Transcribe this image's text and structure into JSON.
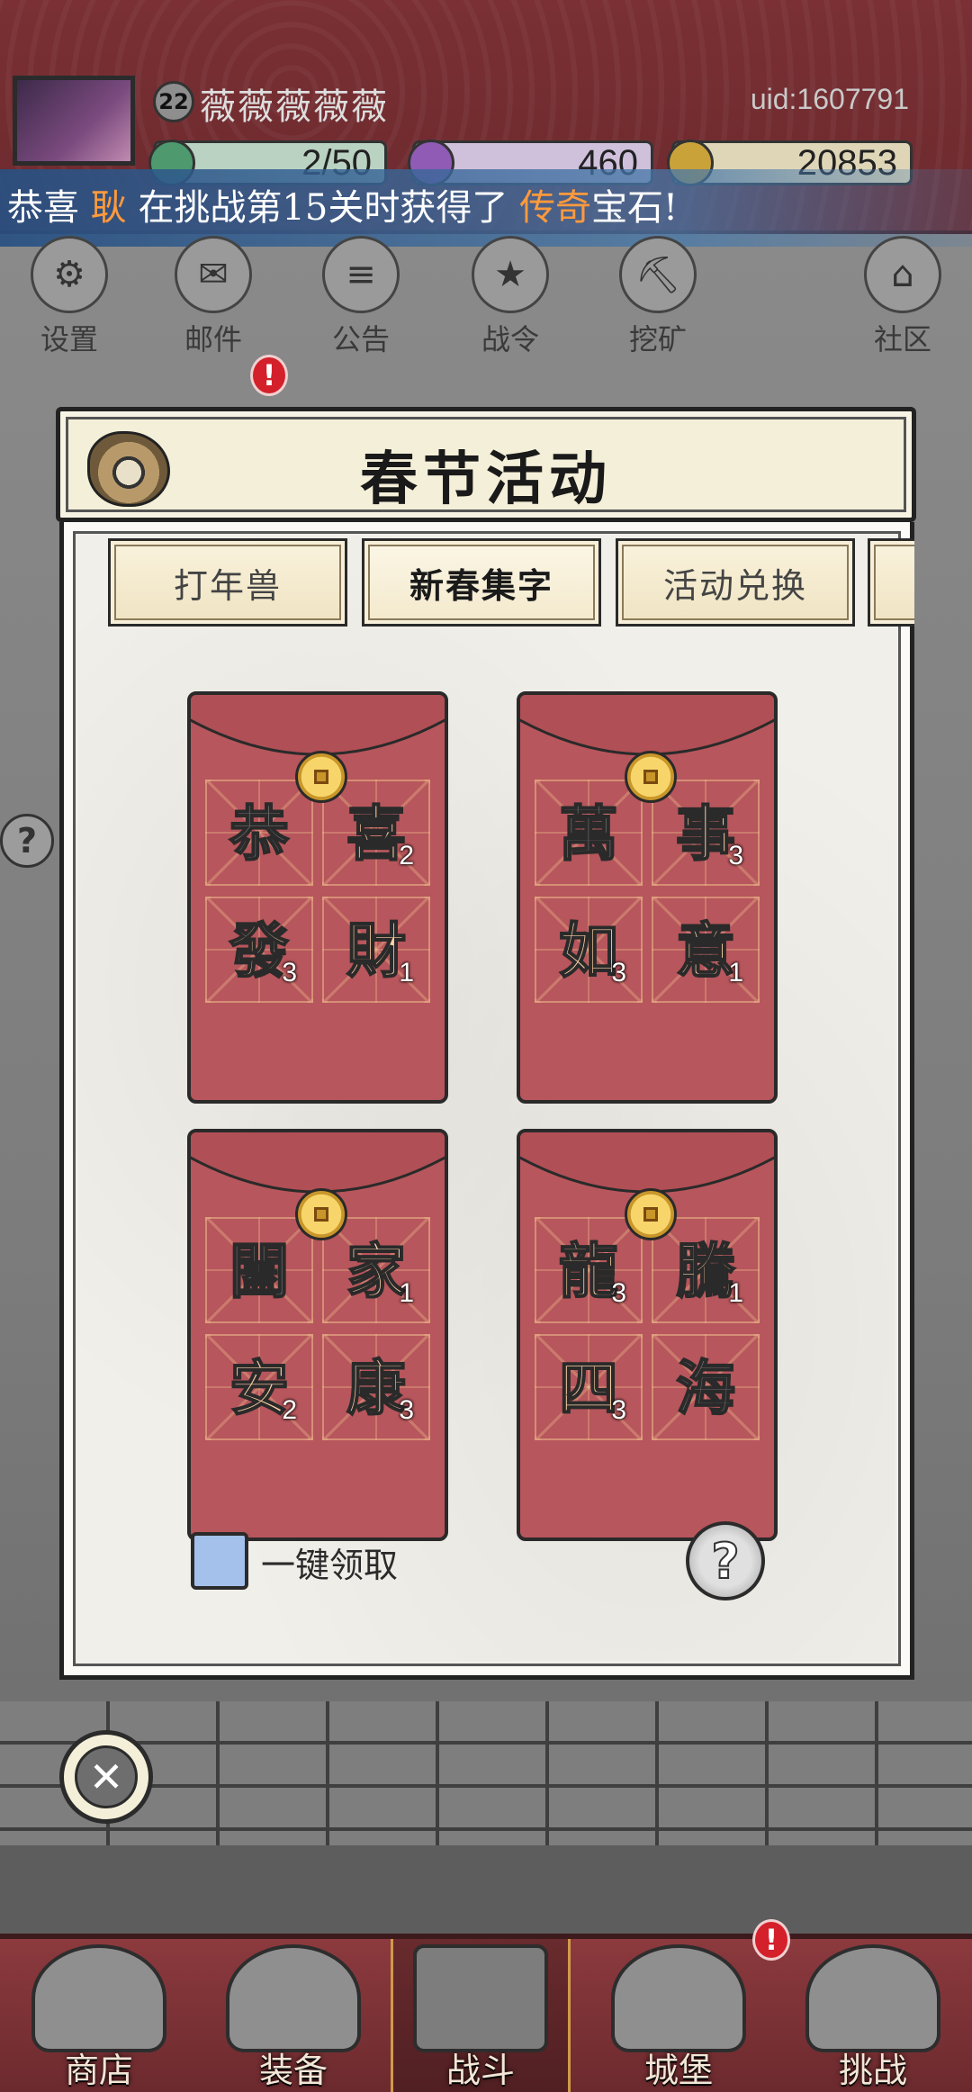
{
  "player": {
    "level": "22",
    "name": "薇薇薇薇薇",
    "uid": "uid:1607791"
  },
  "resources": {
    "stamina": "2/50",
    "gems": "460",
    "gold": "20853"
  },
  "broadcast": {
    "prefix": "恭喜",
    "player": "耿",
    "middle": "在挑战第15关时获得了",
    "item": "传奇",
    "suffix": "宝石!"
  },
  "top_menu": [
    {
      "label": "设置",
      "icon": "gear-icon"
    },
    {
      "label": "邮件",
      "icon": "mail-icon"
    },
    {
      "label": "公告",
      "icon": "scroll-icon"
    },
    {
      "label": "战令",
      "icon": "war-order-icon"
    },
    {
      "label": "挖矿",
      "icon": "mining-icon"
    },
    {
      "label": "社区",
      "icon": "home-icon"
    }
  ],
  "modal": {
    "title": "春节活动",
    "tabs": [
      {
        "label": "打年兽",
        "active": false
      },
      {
        "label": "新春集字",
        "active": true
      },
      {
        "label": "活动兑换",
        "active": false
      }
    ],
    "envelopes": [
      {
        "chars": [
          {
            "char": "恭",
            "count": "",
            "collected": false
          },
          {
            "char": "喜",
            "count": "2",
            "collected": true
          },
          {
            "char": "發",
            "count": "3",
            "collected": true
          },
          {
            "char": "財",
            "count": "1",
            "collected": true
          }
        ]
      },
      {
        "chars": [
          {
            "char": "萬",
            "count": "",
            "collected": false
          },
          {
            "char": "事",
            "count": "3",
            "collected": true
          },
          {
            "char": "如",
            "count": "3",
            "collected": true
          },
          {
            "char": "意",
            "count": "1",
            "collected": true
          }
        ]
      },
      {
        "chars": [
          {
            "char": "闔",
            "count": "",
            "collected": false
          },
          {
            "char": "家",
            "count": "1",
            "collected": true
          },
          {
            "char": "安",
            "count": "2",
            "collected": true
          },
          {
            "char": "康",
            "count": "3",
            "collected": true
          }
        ]
      },
      {
        "chars": [
          {
            "char": "龍",
            "count": "3",
            "collected": true
          },
          {
            "char": "騰",
            "count": "1",
            "collected": true
          },
          {
            "char": "四",
            "count": "3",
            "collected": true
          },
          {
            "char": "海",
            "count": "",
            "collected": false
          }
        ]
      }
    ],
    "one_click_claim": "一键领取",
    "help": "?",
    "close": "✕"
  },
  "bottom_nav": [
    {
      "label": "商店",
      "active": false
    },
    {
      "label": "装备",
      "active": false
    },
    {
      "label": "战斗",
      "active": true
    },
    {
      "label": "城堡",
      "active": false
    },
    {
      "label": "挑战",
      "active": false
    }
  ],
  "colors": {
    "envelope": "#b7565c",
    "collected_char": "#ffd3a8",
    "missing_char": "#6a6a6a",
    "checkbox": "#a3c1ea",
    "broadcast_highlight": "#ff9a3c"
  }
}
